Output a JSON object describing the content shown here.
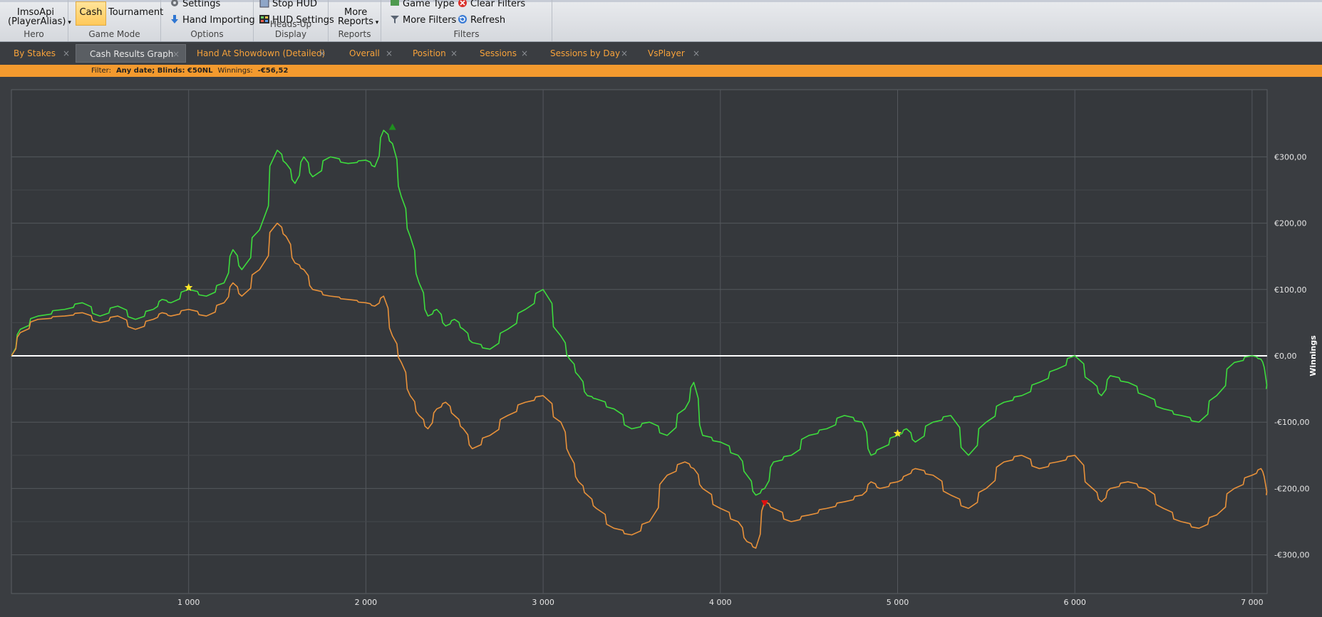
{
  "ribbon": {
    "hero": {
      "label": "Hero",
      "player_name": "ImsoApi",
      "player_alias": "(PlayerAlias)"
    },
    "game_mode": {
      "label": "Game Mode",
      "cash": "Cash",
      "tournament": "Tournament"
    },
    "options": {
      "label": "Options",
      "settings": "Settings",
      "hand_importing": "Hand Importing"
    },
    "hud": {
      "label": "Heads-Up Display",
      "stop_hud": "Stop HUD",
      "hud_settings": "HUD Settings"
    },
    "reports": {
      "label": "Reports",
      "more_reports_line1": "More",
      "more_reports_line2": "Reports"
    },
    "filters": {
      "label": "Filters",
      "game_type": "Game Type",
      "clear_filters": "Clear Filters",
      "more_filters": "More Filters",
      "refresh": "Refresh"
    }
  },
  "tabs": [
    {
      "label": "By Stakes",
      "active": false
    },
    {
      "label": "Cash Results Graph",
      "active": true
    },
    {
      "label": "Hand At Showdown (Detailed)",
      "active": false
    },
    {
      "label": "Overall",
      "active": false
    },
    {
      "label": "Position",
      "active": false
    },
    {
      "label": "Sessions",
      "active": false
    },
    {
      "label": "Sessions by Day",
      "active": false
    },
    {
      "label": "VsPlayer",
      "active": false
    }
  ],
  "filter_bar": {
    "filter_label": "Filter:",
    "filter_value": "Any date; Blinds: €50NL",
    "winnings_label": "Winnings:",
    "winnings_value": "-€56,52"
  },
  "chart_data": {
    "type": "line",
    "xlabel": "",
    "ylabel": "Winnings",
    "xlim": [
      0,
      7100
    ],
    "ylim": [
      -360,
      400
    ],
    "x_ticks": [
      {
        "v": 1000,
        "label": "1 000"
      },
      {
        "v": 2000,
        "label": "2 000"
      },
      {
        "v": 3000,
        "label": "3 000"
      },
      {
        "v": 4000,
        "label": "4 000"
      },
      {
        "v": 5000,
        "label": "5 000"
      },
      {
        "v": 6000,
        "label": "6 000"
      },
      {
        "v": 7000,
        "label": "7 000"
      }
    ],
    "y_ticks": [
      {
        "v": 300,
        "label": "€300,00"
      },
      {
        "v": 200,
        "label": "€200,00"
      },
      {
        "v": 100,
        "label": "€100,00"
      },
      {
        "v": 0,
        "label": "€0,00"
      },
      {
        "v": -100,
        "label": "-€100,00"
      },
      {
        "v": -200,
        "label": "-€200,00"
      },
      {
        "v": -300,
        "label": "-€300,00"
      }
    ],
    "grid": true,
    "colors": {
      "green": "#3ddc3d",
      "orange": "#e8913a",
      "zero": "#ffffff",
      "grid": "#54585d",
      "bg": "#35383c"
    },
    "series": [
      {
        "key": "green",
        "color": "#3ddc3d",
        "x": [
          0,
          50,
          150,
          300,
          400,
          500,
          600,
          700,
          800,
          850,
          900,
          1000,
          1100,
          1200,
          1250,
          1300,
          1400,
          1500,
          1550,
          1600,
          1650,
          1700,
          1800,
          1900,
          2000,
          2050,
          2100,
          2150,
          2200,
          2250,
          2300,
          2350,
          2400,
          2450,
          2500,
          2550,
          2600,
          2700,
          2800,
          2900,
          3000,
          3100,
          3150,
          3200,
          3250,
          3300,
          3400,
          3500,
          3600,
          3700,
          3800,
          3850,
          3900,
          4000,
          4100,
          4150,
          4200,
          4250,
          4300,
          4400,
          4500,
          4600,
          4700,
          4800,
          4850,
          4900,
          5000,
          5050,
          5100,
          5200,
          5300,
          5400,
          5500,
          5600,
          5700,
          5800,
          5900,
          6000,
          6100,
          6150,
          6200,
          6300,
          6400,
          6500,
          6600,
          6700,
          6800,
          6900,
          7000,
          7050,
          7070,
          7080
        ],
        "y": [
          0,
          40,
          60,
          70,
          80,
          60,
          75,
          55,
          70,
          85,
          80,
          100,
          90,
          110,
          160,
          130,
          190,
          310,
          290,
          260,
          300,
          270,
          300,
          290,
          295,
          285,
          340,
          320,
          240,
          180,
          110,
          60,
          70,
          45,
          55,
          40,
          20,
          10,
          40,
          70,
          100,
          30,
          -5,
          -30,
          -60,
          -65,
          -80,
          -110,
          -100,
          -120,
          -80,
          -40,
          -120,
          -130,
          -150,
          -180,
          -210,
          -200,
          -160,
          -150,
          -120,
          -110,
          -90,
          -100,
          -150,
          -140,
          -120,
          -110,
          -130,
          -100,
          -90,
          -150,
          -100,
          -70,
          -60,
          -40,
          -20,
          0,
          -40,
          -60,
          -30,
          -40,
          -60,
          -80,
          -90,
          -100,
          -60,
          -10,
          0,
          -5,
          -20,
          -50
        ]
      },
      {
        "key": "orange",
        "color": "#e8913a",
        "x": [
          0,
          50,
          150,
          300,
          400,
          500,
          600,
          700,
          800,
          850,
          900,
          1000,
          1100,
          1200,
          1250,
          1300,
          1400,
          1500,
          1550,
          1600,
          1650,
          1700,
          1800,
          1900,
          2000,
          2050,
          2100,
          2150,
          2200,
          2250,
          2300,
          2350,
          2400,
          2450,
          2500,
          2550,
          2600,
          2700,
          2800,
          2900,
          3000,
          3100,
          3150,
          3200,
          3250,
          3300,
          3400,
          3500,
          3600,
          3700,
          3800,
          3850,
          3900,
          4000,
          4100,
          4150,
          4200,
          4250,
          4300,
          4400,
          4500,
          4600,
          4700,
          4800,
          4850,
          4900,
          5000,
          5050,
          5100,
          5200,
          5300,
          5400,
          5500,
          5600,
          5700,
          5800,
          5900,
          6000,
          6100,
          6150,
          6200,
          6300,
          6400,
          6500,
          6600,
          6700,
          6800,
          6900,
          7000,
          7050,
          7070,
          7080
        ],
        "y": [
          0,
          35,
          55,
          60,
          65,
          50,
          60,
          40,
          55,
          65,
          60,
          70,
          60,
          80,
          110,
          90,
          130,
          200,
          180,
          140,
          130,
          100,
          90,
          85,
          80,
          75,
          90,
          30,
          -10,
          -60,
          -90,
          -110,
          -80,
          -70,
          -90,
          -110,
          -140,
          -120,
          -90,
          -70,
          -60,
          -100,
          -150,
          -190,
          -210,
          -230,
          -260,
          -270,
          -250,
          -180,
          -160,
          -170,
          -200,
          -230,
          -250,
          -280,
          -290,
          -220,
          -230,
          -250,
          -240,
          -230,
          -220,
          -210,
          -190,
          -200,
          -190,
          -180,
          -170,
          -180,
          -210,
          -230,
          -200,
          -160,
          -150,
          -170,
          -160,
          -150,
          -200,
          -220,
          -200,
          -190,
          -200,
          -230,
          -250,
          -260,
          -240,
          -200,
          -180,
          -170,
          -185,
          -210
        ]
      }
    ],
    "markers": [
      {
        "type": "star",
        "color": "#ffe52a",
        "x": 1000,
        "y": 103
      },
      {
        "type": "triangle-up",
        "color": "#1f8f1f",
        "x": 2150,
        "y": 345
      },
      {
        "type": "triangle-down",
        "color": "#e01010",
        "x": 4250,
        "y": -222
      },
      {
        "type": "star",
        "color": "#ffe52a",
        "x": 5000,
        "y": -117
      }
    ]
  }
}
